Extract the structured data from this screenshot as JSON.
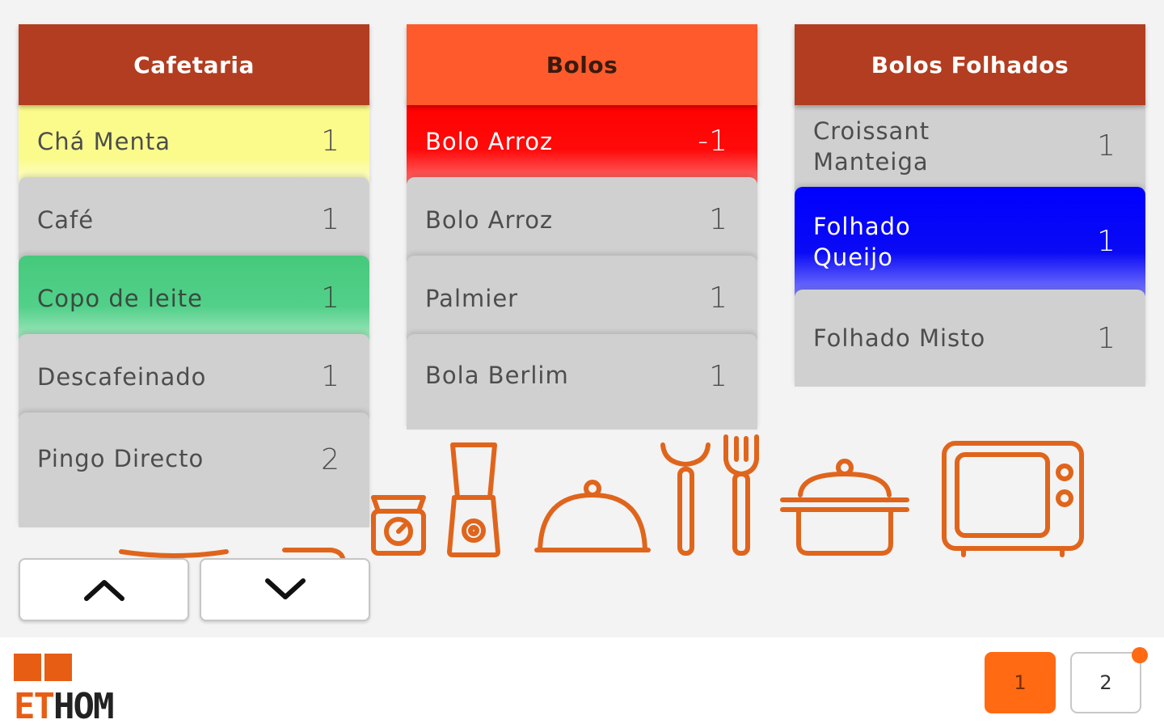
{
  "columns": [
    {
      "title": "Cafetaria",
      "items": [
        {
          "name": "Chá Menta",
          "qty": "1",
          "color": "#fbfb8c"
        },
        {
          "name": "Café",
          "qty": "1",
          "color": "#d0d0d0"
        },
        {
          "name": "Copo de leite",
          "qty": "1",
          "color": "#46c97c"
        },
        {
          "name": "Descafeinado",
          "qty": "1",
          "color": "#d0d0d0"
        },
        {
          "name": "Pingo Directo",
          "qty": "2",
          "color": "#d0d0d0"
        }
      ]
    },
    {
      "title": "Bolos",
      "items": [
        {
          "name": "Bolo Arroz",
          "qty": "-1",
          "color": "#ff0000"
        },
        {
          "name": "Bolo Arroz",
          "qty": "1",
          "color": "#d0d0d0"
        },
        {
          "name": "Palmier",
          "qty": "1",
          "color": "#d0d0d0"
        },
        {
          "name": "Bola Berlim",
          "qty": "1",
          "color": "#d0d0d0"
        }
      ]
    },
    {
      "title": "Bolos Folhados",
      "items": [
        {
          "name_line1": "Croissant",
          "name_line2": "Manteiga",
          "qty": "1",
          "color": "#d0d0d0"
        },
        {
          "name_line1": "Folhado",
          "name_line2": "Queijo",
          "qty": "1",
          "color": "#0000ff"
        },
        {
          "name": "Folhado Misto",
          "qty": "1",
          "color": "#d0d0d0"
        }
      ]
    }
  ],
  "nav": {
    "up_icon": "chevron-up-icon",
    "down_icon": "chevron-down-icon"
  },
  "footer": {
    "logo_text_part1": "ET",
    "logo_text_part2": "HOM",
    "pages": [
      "1",
      "2"
    ],
    "active_page": "1"
  },
  "theme": {
    "header_dark": "#b23d20",
    "header_orange": "#ff5a2b",
    "accent": "#ff6a13",
    "illustration_stroke": "#e0651c"
  }
}
